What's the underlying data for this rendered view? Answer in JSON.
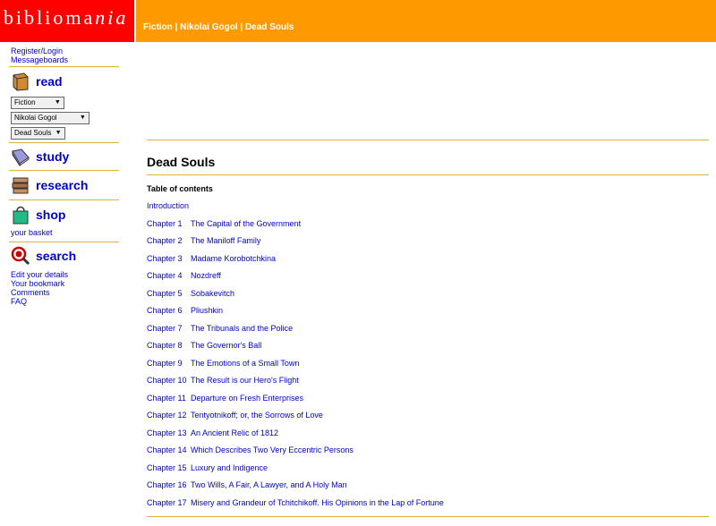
{
  "logo": {
    "text": "biblioma",
    "suffix": "nia"
  },
  "breadcrumb": {
    "items": [
      "Fiction",
      "Nikolai Gogol",
      "Dead Souls"
    ],
    "sep": "|"
  },
  "sidebar": {
    "account_links": [
      "Register/Login",
      "Messageboards"
    ],
    "read": {
      "label": "read",
      "selects": [
        {
          "value": "Fiction"
        },
        {
          "value": "Nikolai Gogol"
        },
        {
          "value": "Dead Souls"
        }
      ]
    },
    "study": {
      "label": "study"
    },
    "research": {
      "label": "research"
    },
    "shop": {
      "label": "shop",
      "basket": "your basket"
    },
    "search": {
      "label": "search"
    },
    "bottom_links": [
      "Edit your details",
      "Your bookmark",
      "Comments",
      "FAQ"
    ]
  },
  "main": {
    "title": "Dead Souls",
    "toc_heading": "Table of contents",
    "toc": [
      {
        "num": "",
        "title": "Introduction"
      },
      {
        "num": "Chapter 1",
        "title": "The Capital of the Government"
      },
      {
        "num": "Chapter 2",
        "title": "The Maniloff Family"
      },
      {
        "num": "Chapter 3",
        "title": "Madame Korobotchkina"
      },
      {
        "num": "Chapter 4",
        "title": "Nozdreff"
      },
      {
        "num": "Chapter 5",
        "title": "Sobakevitch"
      },
      {
        "num": "Chapter 6",
        "title": "Pliushkin"
      },
      {
        "num": "Chapter 7",
        "title": "The Tribunals and the Police"
      },
      {
        "num": "Chapter 8",
        "title": "The Governor's Ball"
      },
      {
        "num": "Chapter 9",
        "title": "The Emotions of a Small Town"
      },
      {
        "num": "Chapter 10",
        "title": "The Result is our Hero's Flight"
      },
      {
        "num": "Chapter 11",
        "title": "Departure on Fresh Enterprises"
      },
      {
        "num": "Chapter 12",
        "title": "Tentyotnikoff; or, the Sorrows of Love"
      },
      {
        "num": "Chapter 13",
        "title": "An Ancient Relic of 1812"
      },
      {
        "num": "Chapter 14",
        "title": "Which Describes Two Very Eccentric Persons"
      },
      {
        "num": "Chapter 15",
        "title": "Luxury and Indigence"
      },
      {
        "num": "Chapter 16",
        "title": "Two Wills, A Fair, A Lawyer, and A Holy Man"
      },
      {
        "num": "Chapter 17",
        "title": "Misery and Grandeur of Tchitchikoff. His Opinions in the Lap of Fortune"
      }
    ]
  },
  "colors": {
    "logo_bg": "#ff0000",
    "topbar_bg": "#ff9900",
    "rule": "#e0b040",
    "link": "#0000cc"
  }
}
